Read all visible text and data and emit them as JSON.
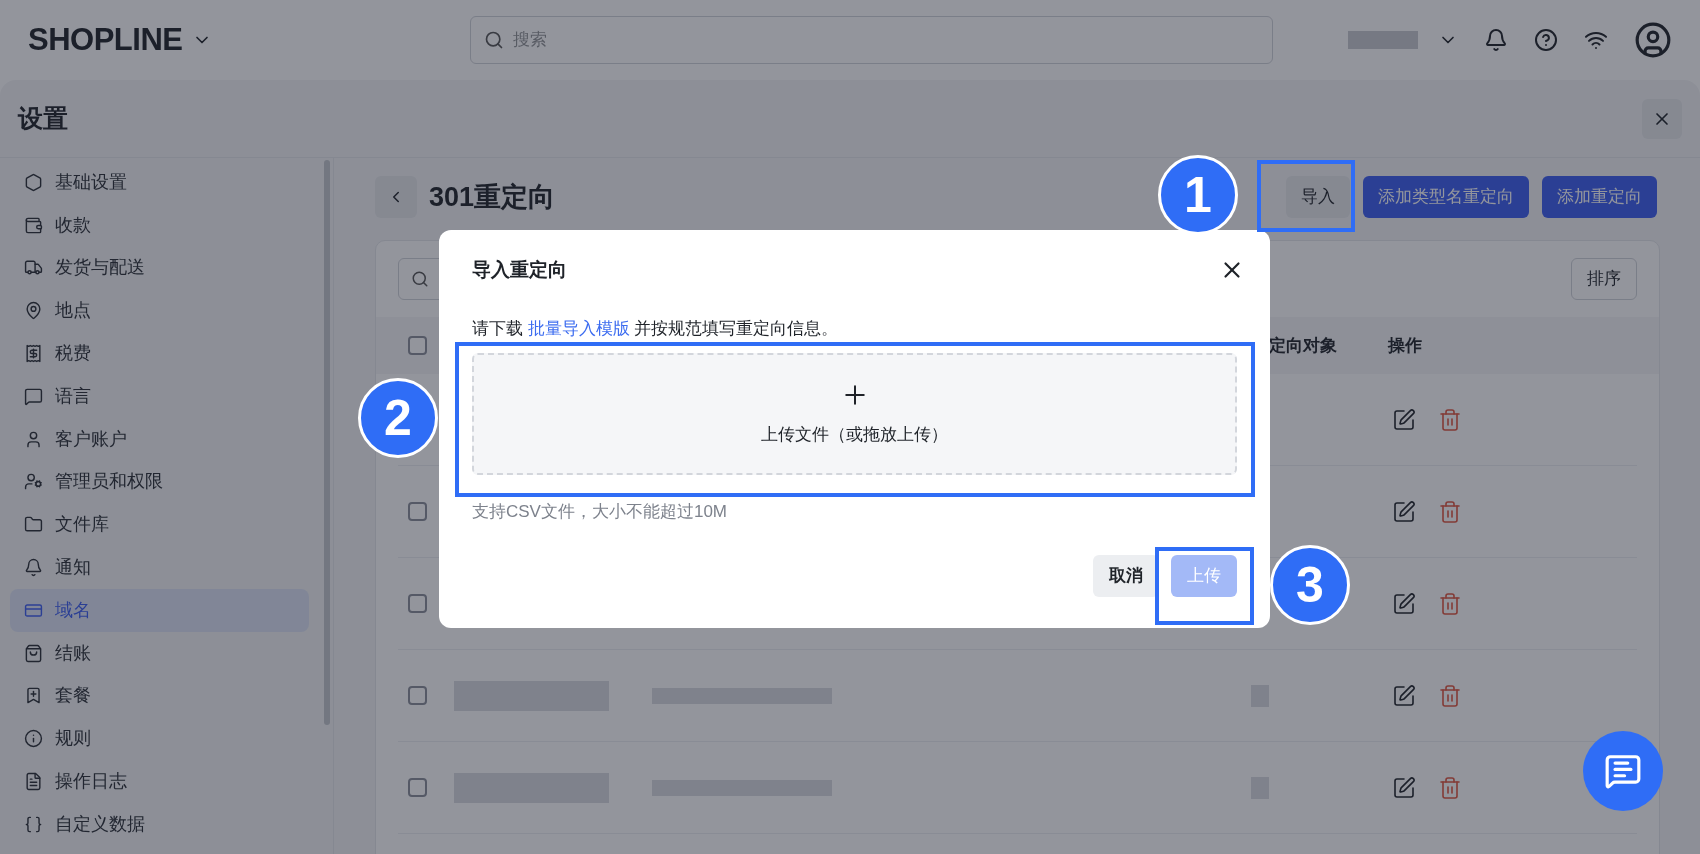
{
  "header": {
    "logo": "SHOPLINE",
    "search": {
      "placeholder": "搜索"
    }
  },
  "settings": {
    "title": "设置"
  },
  "sidebar": {
    "items": [
      {
        "label": "基础设置",
        "selected": false
      },
      {
        "label": "收款",
        "selected": false
      },
      {
        "label": "发货与配送",
        "selected": false
      },
      {
        "label": "地点",
        "selected": false
      },
      {
        "label": "税费",
        "selected": false
      },
      {
        "label": "语言",
        "selected": false
      },
      {
        "label": "客户账户",
        "selected": false
      },
      {
        "label": "管理员和权限",
        "selected": false
      },
      {
        "label": "文件库",
        "selected": false
      },
      {
        "label": "通知",
        "selected": false
      },
      {
        "label": "域名",
        "selected": true
      },
      {
        "label": "结账",
        "selected": false
      },
      {
        "label": "套餐",
        "selected": false
      },
      {
        "label": "规则",
        "selected": false
      },
      {
        "label": "操作日志",
        "selected": false
      },
      {
        "label": "自定义数据",
        "selected": false
      }
    ]
  },
  "page": {
    "title": "301重定向",
    "buttons": [
      {
        "label": "导入",
        "kind": "secondary"
      },
      {
        "label": "添加类型名重定向",
        "kind": "primary"
      },
      {
        "label": "添加重定向",
        "kind": "primary"
      }
    ]
  },
  "table": {
    "sort_button": "排序",
    "header_checked": false,
    "columns": [
      "定向对象",
      "操作"
    ],
    "rows": [
      {},
      {
        "checked": false
      },
      {
        "checked": false
      },
      {
        "checked": false
      },
      {
        "checked": false
      }
    ]
  },
  "modal": {
    "title": "导入重定向",
    "description": {
      "before": "请下载 ",
      "link": "批量导入模版",
      "after": " 并按规范填写重定向信息。"
    },
    "dropzone": {
      "label": "上传文件（或拖放上传）"
    },
    "hint": "支持CSV文件，大小不能超过10M",
    "buttons": [
      {
        "label": "取消",
        "kind": "cancel",
        "disabled": false
      },
      {
        "label": "上传",
        "kind": "primary",
        "disabled": true
      }
    ]
  },
  "annotations": [
    {
      "label": "1"
    },
    {
      "label": "2"
    },
    {
      "label": "3"
    }
  ]
}
